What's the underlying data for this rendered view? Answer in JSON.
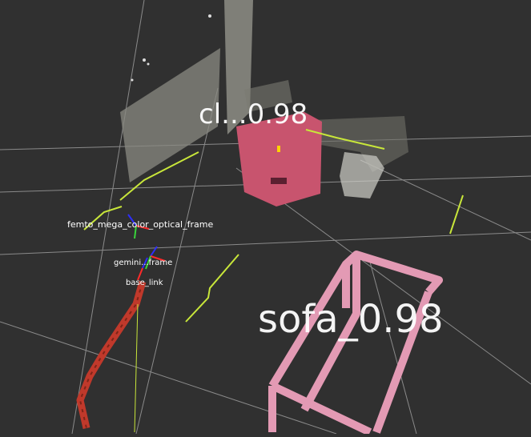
{
  "viewport": {
    "background": "#303030",
    "grid_color": "#a0a0a0"
  },
  "frames": {
    "camera": "femto_mega_color_optical_frame",
    "overlap": "gemini...frame",
    "base": "base_link"
  },
  "detections": {
    "sofa_label": "sofa_0.98",
    "cluster_label": "cl...0.98",
    "sofa_box_color": "#e39ab4",
    "object_color": "#c8546e"
  },
  "colors": {
    "path": "#c0392b",
    "laser": "#c8e63a",
    "axis_x": "#ff2a2a",
    "axis_y": "#39d43b",
    "axis_z": "#2d2dff"
  }
}
